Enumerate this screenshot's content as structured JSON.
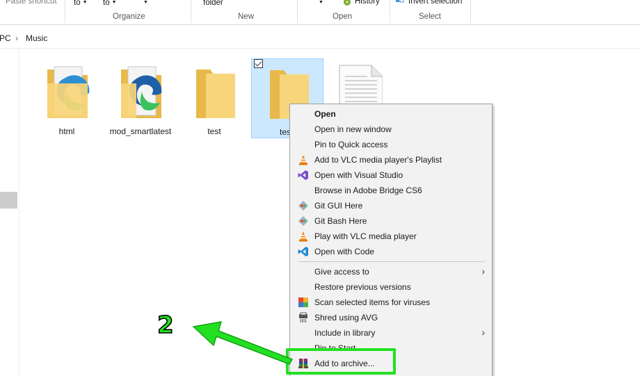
{
  "ribbon": {
    "paste_shortcut": "Paste shortcut",
    "move_to": "to",
    "copy_to": "to",
    "new_folder": "folder",
    "history": "History",
    "invert_selection": "Invert selection",
    "groups": {
      "organize": "Organize",
      "new": "New",
      "open": "Open",
      "select": "Select"
    }
  },
  "address": {
    "root": "PC",
    "separator": "›",
    "folder": "Music"
  },
  "files": [
    {
      "name": "html",
      "icon": "folder-edge-icon"
    },
    {
      "name": "mod_smartlatest",
      "icon": "folder-edge-icon"
    },
    {
      "name": "test",
      "icon": "folder-icon"
    },
    {
      "name": "tes",
      "icon": "folder-icon",
      "selected": true
    },
    {
      "name": "",
      "icon": "document-icon"
    }
  ],
  "context_menu": {
    "items": [
      {
        "label": "Open",
        "bold": true
      },
      {
        "label": "Open in new window"
      },
      {
        "label": "Pin to Quick access"
      },
      {
        "label": "Add to VLC media player's Playlist",
        "icon": "vlc-icon"
      },
      {
        "label": "Open with Visual Studio",
        "icon": "visual-studio-icon"
      },
      {
        "label": "Browse in Adobe Bridge CS6"
      },
      {
        "label": "Git GUI Here",
        "icon": "git-icon"
      },
      {
        "label": "Git Bash Here",
        "icon": "git-icon"
      },
      {
        "label": "Play with VLC media player",
        "icon": "vlc-icon"
      },
      {
        "label": "Open with Code",
        "icon": "vscode-icon"
      },
      {
        "label": "Give access to",
        "submenu": true
      },
      {
        "label": "Restore previous versions"
      },
      {
        "label": "Scan selected items for viruses",
        "icon": "avg-icon"
      },
      {
        "label": "Shred using AVG",
        "icon": "shredder-icon"
      },
      {
        "label": "Include in library",
        "submenu": true
      },
      {
        "label": "Pin to Start"
      },
      {
        "label": "Add to archive...",
        "icon": "winrar-icon"
      }
    ]
  },
  "annotation": {
    "step_number": "2",
    "color": "#22e022"
  }
}
